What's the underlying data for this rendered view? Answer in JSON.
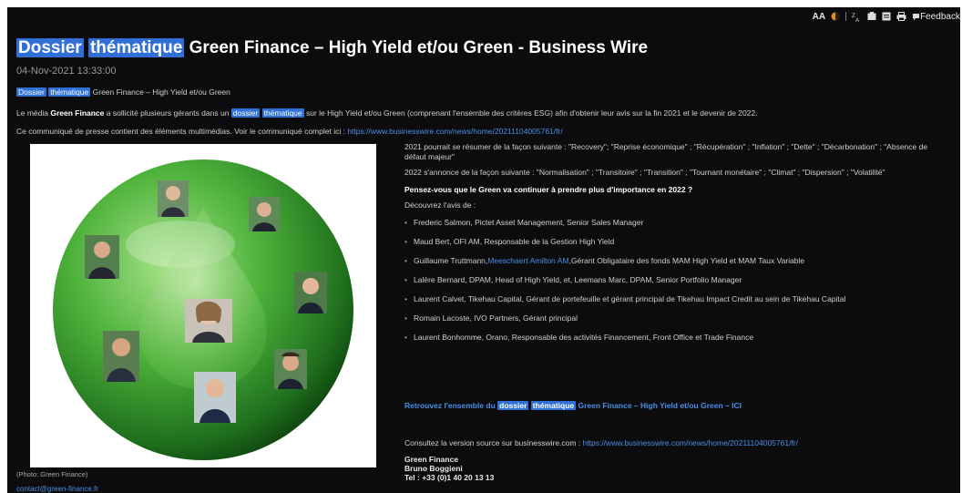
{
  "toolbar": {
    "text_size": "AA",
    "items": [
      {
        "name": "contrast-icon"
      },
      {
        "name": "translate-icon"
      },
      {
        "name": "save-icon"
      },
      {
        "name": "reader-icon"
      },
      {
        "name": "print-icon"
      }
    ],
    "feedback": "Feedback"
  },
  "article": {
    "title_hl1": "Dossier",
    "title_hl2": "thématique",
    "title_rest": "Green Finance – High Yield et/ou Green - Business Wire",
    "date": "04-Nov-2021 13:33:00",
    "sub_hl1": "Dossier",
    "sub_hl2": "thématique",
    "sub_rest": "Green Finance – High Yield et/ou Green",
    "intro_a": "Le média ",
    "intro_bold": "Green Finance",
    "intro_b": " a sollicité plusieurs gérants dans un ",
    "intro_hl1": "dossier",
    "intro_hl2": "thématique",
    "intro_c": " sur le High Yield et/ou Green (comprenant l'ensemble des critères ESG) afin d'obtenir leur avis sur la fin 2021 et le devenir de 2022.",
    "notice": "Ce communiqué de presse contient des éléments multimédias. Voir le communiqué complet ici : ",
    "notice_link": "https://www.businesswire.com/news/home/20211104005761/fr/",
    "caption": "(Photo: Green Finance)",
    "contact_link": "contact@green-finance.fr"
  },
  "right": {
    "p2021": "2021 pourrait se résumer de la façon suivante : \"Recovery\"; \"Reprise économique\" ; \"Récupération\" ; \"Inflation\" ; \"Dette\" ; \"Décarbonation\" ; \"Absence de défaut majeur\"",
    "p2022": "2022 s'annonce de la façon suivante : \"Normalisation\" ; \"Transitoire\" ; \"Transition\" ; \"Tournant monétaire\" ; \"Climat\" ; \"Dispersion\" ; \"Volatilité\"",
    "question": "Pensez-vous que le Green va continuer à prendre plus d'importance en 2022 ?",
    "discover": "Découvrez l'avis de :",
    "people": [
      "Frederic Salmon, Pictet Asset Management, Senior Sales Manager",
      "Maud Bert, OFI AM, Responsable de la Gestion High Yield",
      "Guillaume Truttmann, Meeschaert Amilton AM, Gérant Obligataire des fonds MAM High Yield et MAM Taux Variable",
      "Lalère Bernard, DPAM, Head of High Yield, et, Leemans Marc, DPAM, Senior Portfolio Manager",
      "Laurent Calvet, Tikehau Capital, Gérant de portefeuille et gérant principal de Tikehau Impact Credit au sein de Tikehau Capital",
      "Romain Lacoste, IVO Partners, Gérant principal",
      "Laurent Bonhomme, Orano, Responsable des activités Financement, Front Office et Trade Finance"
    ],
    "person3_pre": "Guillaume Truttmann,",
    "person3_link": "Meeschaert Amilton AM",
    "person3_post": ",Gérant Obligataire des fonds MAM High Yield et MAM Taux Variable",
    "more_a": "Retrouvez l'ensemble du ",
    "more_hl1": "dossier",
    "more_hl2": "thématique",
    "more_b": " Green Finance – High Yield et/ou Green – ICI",
    "source_text": "Consultez la version source sur businesswire.com : ",
    "source_link": "https://www.businesswire.com/news/home/20211104005761/fr/",
    "contact_name": "Green Finance",
    "contact_person": "Bruno Boggieni",
    "contact_tel": "Tel : +33 (0)1 40 20 13 13"
  },
  "colors": {
    "background": "#0c0c0e",
    "highlight": "#2f6fd6",
    "link": "#4a8fe6",
    "sphere": "#3fa93a"
  }
}
